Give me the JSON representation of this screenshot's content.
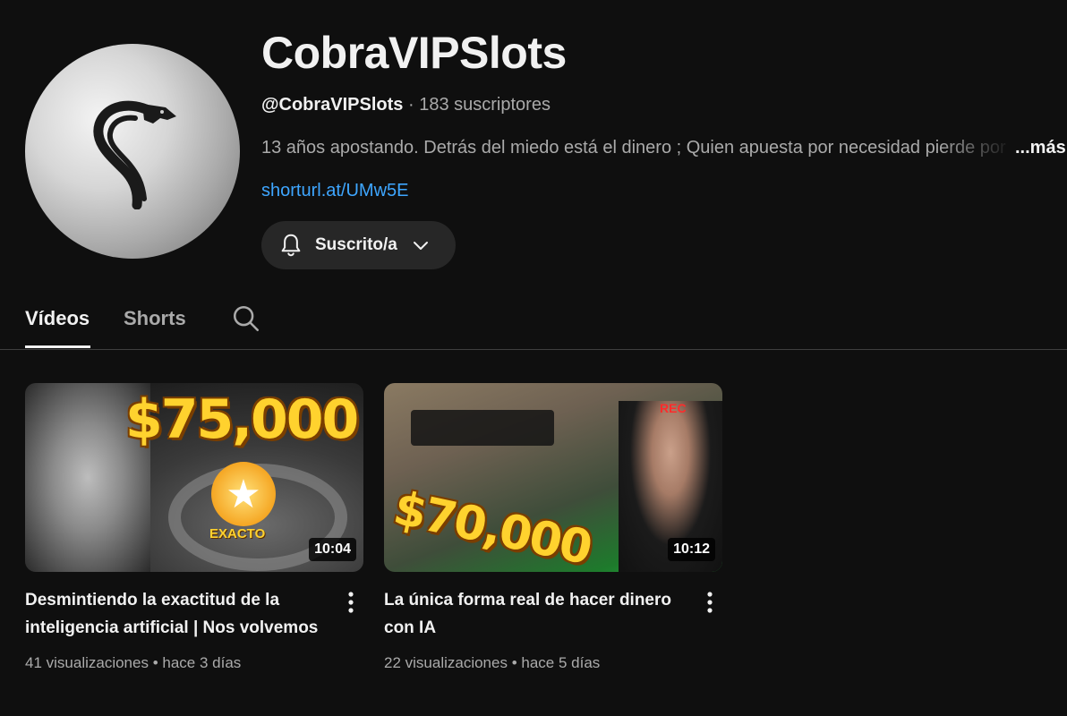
{
  "channel": {
    "name": "CobraVIPSlots",
    "handle": "@CobraVIPSlots",
    "separator": " · ",
    "subscribers": "183 suscriptores",
    "description": "13 años apostando. Detrás del miedo está el dinero ; Quien apuesta por necesidad pierde por",
    "more_label": "...más",
    "link": "shorturl.at/UMw5E",
    "subscribe_label": "Suscrito/a"
  },
  "tabs": {
    "videos": "Vídeos",
    "shorts": "Shorts"
  },
  "videos": [
    {
      "title": "Desmintiendo la exactitud de la inteligencia artificial | Nos volvemos",
      "duration": "10:04",
      "views": "41 visualizaciones",
      "age": "hace 3 días",
      "thumb_text": "$75,000",
      "thumb_badge": "EXACTO"
    },
    {
      "title": "La única forma real de hacer dinero con IA",
      "duration": "10:12",
      "views": "22 visualizaciones",
      "age": "hace 5 días",
      "thumb_text": "$70,000",
      "thumb_badge": "REC"
    }
  ],
  "stats_separator": " • ",
  "colors": {
    "background": "#0f0f0f",
    "link": "#3ea6ff",
    "muted_text": "#aaaaaa",
    "button_bg": "#272727"
  },
  "icons": {
    "avatar": "cobra-logo-icon",
    "bell": "bell-icon",
    "chevron": "chevron-down-icon",
    "search": "search-icon",
    "kebab": "more-vert-icon"
  }
}
